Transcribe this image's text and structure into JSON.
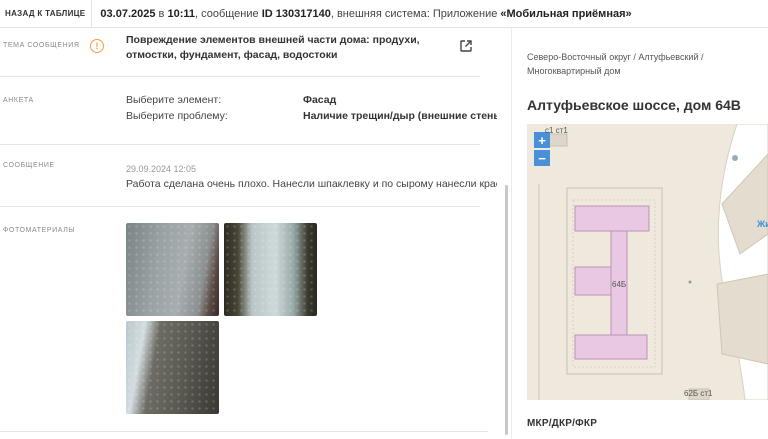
{
  "topbar": {
    "back_label": "НАЗАД К ТАБЛИЦЕ",
    "date": "03.07.2025",
    "in_word": " в ",
    "time": "10:11",
    "message_word": ", сообщение ",
    "message_id": "ID 130317140",
    "system_text": ", внешняя система: Приложение ",
    "system_name": "«Мобильная приёмная»"
  },
  "topic": {
    "label": "ТЕМА СООБЩЕНИЯ",
    "text": "Повреждение элементов внешней части дома: продухи, отмостки, фундамент, фасад, водостоки",
    "icons": {
      "warning": "warning-circle-icon",
      "external": "external-link-icon"
    },
    "accent_color": "#f2a03d"
  },
  "survey": {
    "label": "АНКЕТА",
    "items": [
      {
        "key": "Выберите элемент:",
        "value": "Фасад"
      },
      {
        "key": "Выберите проблему:",
        "value": "Наличие трещин/дыр (внешние стены)"
      }
    ]
  },
  "message": {
    "label": "СООБЩЕНИЕ",
    "date": "29.09.2024 12:05",
    "text": "Работа сделана очень плохо. Нанесли шпаклевку и по сырому нанесли краску."
  },
  "photos": {
    "label": "ФОТОМАТЕРИАЛЫ",
    "count": 3
  },
  "location": {
    "breadcrumbs": "Северо-Восточный округ / Алтуфьевский / Многоквартирный дом",
    "address": "Алтуфьевское шоссе, дом 64В",
    "map": {
      "zoom_in": "+",
      "zoom_out": "−",
      "labels": [
        "64Б",
        "62Б ст1",
        "с1 ст1",
        "Жи"
      ]
    },
    "footer_label": "МКР/ДКР/ФКР"
  }
}
